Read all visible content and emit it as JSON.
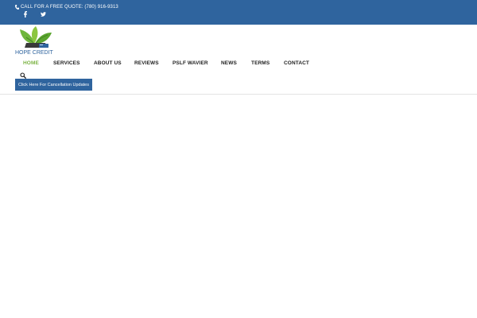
{
  "topbar": {
    "phone_text": "CALL FOR A FREE QUOTE: (780) 916-9313",
    "phone_icon": "phone-icon",
    "social": [
      {
        "icon": "facebook-icon",
        "glyph": "f"
      },
      {
        "icon": "twitter-icon"
      }
    ],
    "bg_color": "#2f649e"
  },
  "logo": {
    "text": "HOPE CREDIT"
  },
  "nav": {
    "items": [
      {
        "label": "HOME",
        "active": true
      },
      {
        "label": "SERVICES"
      },
      {
        "label": "ABOUT US"
      },
      {
        "label": "REVIEWS"
      },
      {
        "label": "PSLF WAVIER"
      },
      {
        "label": "NEWS"
      },
      {
        "label": "TERMS"
      },
      {
        "label": "CONTACT"
      }
    ],
    "active_color": "#7bb343"
  },
  "search": {
    "icon": "search-icon"
  },
  "cta": {
    "label": "Click Here For Cancellation Updates"
  }
}
